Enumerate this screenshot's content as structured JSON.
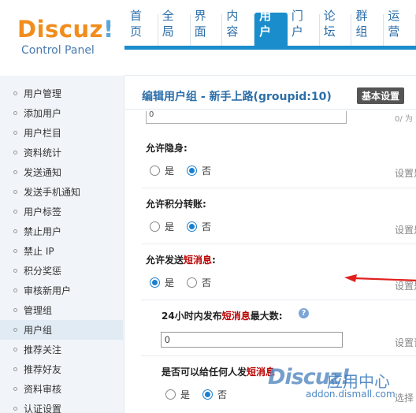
{
  "logo": {
    "brand_first": "Discuz",
    "brand_bang": "!",
    "subtitle": "Control Panel"
  },
  "nav": {
    "items": [
      "首页",
      "全局",
      "界面",
      "内容",
      "用户",
      "门户",
      "论坛",
      "群组",
      "运营"
    ],
    "active_index": 4
  },
  "sidebar": {
    "items": [
      "用户管理",
      "添加用户",
      "用户栏目",
      "资料统计",
      "发送通知",
      "发送手机通知",
      "用户标签",
      "禁止用户",
      "禁止 IP",
      "积分奖惩",
      "审核新用户",
      "管理组",
      "用户组",
      "推荐关注",
      "推荐好友",
      "资料审核",
      "认证设置"
    ],
    "active_index": 12
  },
  "main": {
    "title": "编辑用户组 - 新手上路(groupid:10)",
    "tab": "基本设置",
    "partial_input_value": "0",
    "partial_right_hint": "0/ 为",
    "settings": [
      {
        "label": "允许隐身:",
        "yes": "是",
        "no": "否",
        "selected": "no",
        "hint": "设置是"
      },
      {
        "label": "允许积分转账:",
        "yes": "是",
        "no": "否",
        "selected": "no",
        "hint": "设置是"
      },
      {
        "label_pre": "允许发送",
        "label_red": "短消息",
        "label_post": ":",
        "yes": "是",
        "no": "否",
        "selected": "yes",
        "hint": "设置是"
      },
      {
        "label_pre": "24小时内发布",
        "label_red": "短消息",
        "label_post": "最大数:",
        "value": "0",
        "hint": "设置该"
      },
      {
        "label_pre": "是否可以给任何人发",
        "label_red": "短消息",
        "yes": "是",
        "no": "否",
        "selected": "no",
        "hint": "选择"
      }
    ],
    "help_icon": "?"
  },
  "watermark": {
    "logo": "Discuz!",
    "cn": "应用中心",
    "url": "addon.dismall.com"
  },
  "colors": {
    "accent": "#1a8dcc",
    "link": "#2b6ea9",
    "highlight_red": "#b00",
    "arrow": "#e0201c"
  }
}
